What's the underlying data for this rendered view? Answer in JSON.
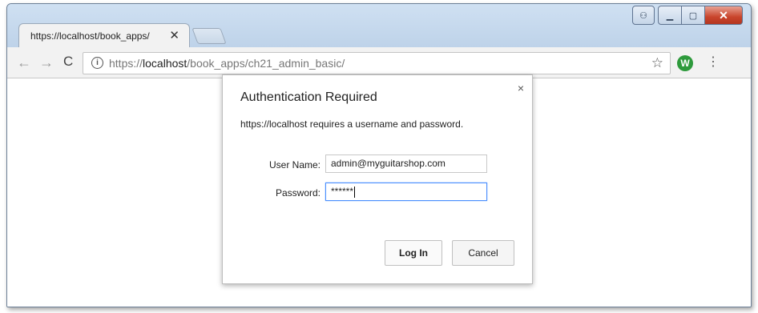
{
  "tab": {
    "title": "https://localhost/book_apps/",
    "close": "✕"
  },
  "toolbar": {
    "back": "←",
    "forward": "→",
    "reload": "C",
    "info": "i",
    "url_scheme": "https://",
    "url_host": "localhost",
    "url_path": "/book_apps/ch21_admin_basic/",
    "star": "☆",
    "extension": "W",
    "menu": "⋮"
  },
  "window_controls": {
    "user": "⚇",
    "minimize": "▁",
    "maximize": "▢",
    "close": "✕"
  },
  "dialog": {
    "close": "×",
    "title": "Authentication Required",
    "message": "https://localhost requires a username and password.",
    "username_label": "User Name:",
    "username_value": "admin@myguitarshop.com",
    "password_label": "Password:",
    "password_value": "******",
    "login_button": "Log In",
    "cancel_button": "Cancel"
  }
}
